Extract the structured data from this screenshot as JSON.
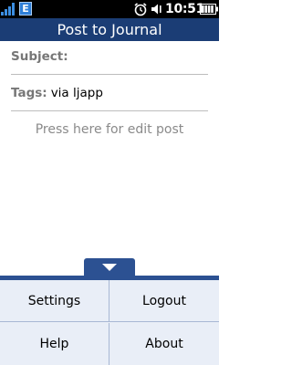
{
  "status_bar": {
    "network_type": "E",
    "time": "10:51",
    "icons": [
      "signal-strength-icon",
      "alarm-icon",
      "speaker-icon",
      "battery-icon"
    ]
  },
  "header": {
    "title": "Post to Journal"
  },
  "form": {
    "subject_label": "Subject:",
    "subject_value": "",
    "tags_label": "Tags:",
    "tags_value": "via ljapp",
    "edit_hint": "Press here for edit post"
  },
  "menu": {
    "toggle_icon": "chevron-down-icon",
    "items": [
      {
        "label": "Settings"
      },
      {
        "label": "Logout"
      },
      {
        "label": "Help"
      },
      {
        "label": "About"
      }
    ]
  },
  "colors": {
    "title_bar": "#1b3d75",
    "menu_accent": "#2c5192",
    "menu_background": "#e9eef7",
    "label_gray": "#777777"
  }
}
